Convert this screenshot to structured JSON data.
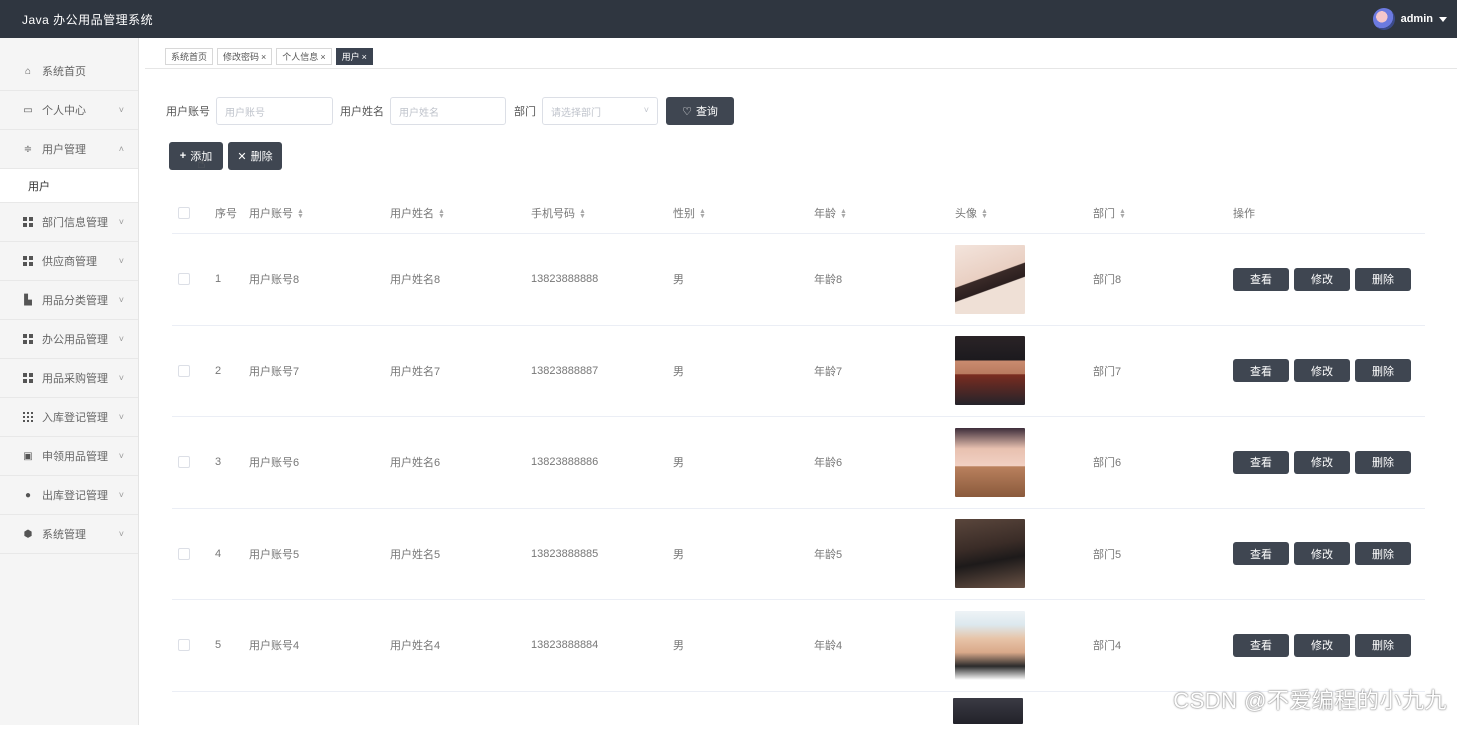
{
  "header": {
    "title": "Java 办公用品管理系统",
    "user": "admin"
  },
  "sidebar": {
    "items": [
      {
        "label": "系统首页",
        "icon": "home-icon"
      },
      {
        "label": "个人中心",
        "icon": "calendar-icon",
        "arrow": "˅"
      },
      {
        "label": "用户管理",
        "icon": "filter-icon",
        "arrow": "˄",
        "expanded": true
      },
      {
        "label": "部门信息管理",
        "icon": "grid-icon",
        "arrow": "˅"
      },
      {
        "label": "供应商管理",
        "icon": "grid-icon",
        "arrow": "˅"
      },
      {
        "label": "用品分类管理",
        "icon": "category-icon",
        "arrow": "˅"
      },
      {
        "label": "办公用品管理",
        "icon": "grid-icon",
        "arrow": "˅"
      },
      {
        "label": "用品采购管理",
        "icon": "grid-icon",
        "arrow": "˅"
      },
      {
        "label": "入库登记管理",
        "icon": "grid9-icon",
        "arrow": "˅"
      },
      {
        "label": "申领用品管理",
        "icon": "clipboard-icon",
        "arrow": "˅"
      },
      {
        "label": "出库登记管理",
        "icon": "person-icon",
        "arrow": "˅"
      },
      {
        "label": "系统管理",
        "icon": "shield-icon",
        "arrow": "˅"
      }
    ],
    "subitem": "用户"
  },
  "tabs": [
    {
      "label": "系统首页",
      "closable": false
    },
    {
      "label": "修改密码",
      "closable": true
    },
    {
      "label": "个人信息",
      "closable": true
    },
    {
      "label": "用户",
      "closable": true,
      "active": true
    }
  ],
  "filter": {
    "account_label": "用户账号",
    "account_placeholder": "用户账号",
    "name_label": "用户姓名",
    "name_placeholder": "用户姓名",
    "dept_label": "部门",
    "dept_placeholder": "请选择部门",
    "search_label": "查询"
  },
  "actions": {
    "add_label": "添加",
    "delete_label": "删除"
  },
  "table": {
    "headers": {
      "index": "序号",
      "account": "用户账号",
      "name": "用户姓名",
      "phone": "手机号码",
      "sex": "性别",
      "age": "年龄",
      "avatar": "头像",
      "dept": "部门",
      "ops": "操作"
    },
    "rows": [
      {
        "index": "1",
        "account": "用户账号8",
        "name": "用户姓名8",
        "phone": "13823888888",
        "sex": "男",
        "age": "年龄8",
        "dept": "部门8",
        "avatar_color": "#e8d6cc"
      },
      {
        "index": "2",
        "account": "用户账号7",
        "name": "用户姓名7",
        "phone": "13823888887",
        "sex": "男",
        "age": "年龄7",
        "dept": "部门7",
        "avatar_color": "#3a2c30"
      },
      {
        "index": "3",
        "account": "用户账号6",
        "name": "用户姓名6",
        "phone": "13823888886",
        "sex": "男",
        "age": "年龄6",
        "dept": "部门6",
        "avatar_color": "#b88a6a"
      },
      {
        "index": "4",
        "account": "用户账号5",
        "name": "用户姓名5",
        "phone": "13823888885",
        "sex": "男",
        "age": "年龄5",
        "dept": "部门5",
        "avatar_color": "#4a3a33"
      },
      {
        "index": "5",
        "account": "用户账号4",
        "name": "用户姓名4",
        "phone": "13823888884",
        "sex": "男",
        "age": "年龄4",
        "dept": "部门4",
        "avatar_color": "#dfe8ee"
      }
    ],
    "ops": {
      "view": "查看",
      "edit": "修改",
      "delete": "删除"
    }
  },
  "watermark": "CSDN @不爱编程的小九九",
  "colors": {
    "header_bg": "#2f3640",
    "button_dark": "#3f4651"
  }
}
